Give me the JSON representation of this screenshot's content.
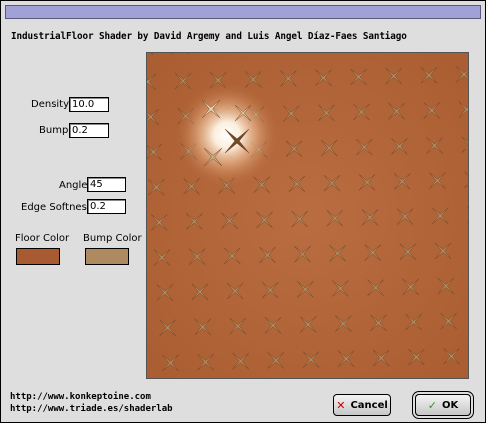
{
  "window": {
    "title": ""
  },
  "heading": "IndustrialFloor Shader by David Argemy and Luis Angel Díaz-Faes Santiago",
  "params": {
    "density": {
      "label": "Density",
      "value": "10.0"
    },
    "bump": {
      "label": "Bump",
      "value": "0.2"
    },
    "angle": {
      "label": "Angle",
      "value": "45"
    },
    "edge_softness": {
      "label": "Edge Softness",
      "value": "0.2"
    }
  },
  "colors": {
    "floor": {
      "label": "Floor Color",
      "value": "#a85a30"
    },
    "bump": {
      "label": "Bump Color",
      "value": "#ad8a60"
    }
  },
  "preview": {
    "base_color": "#b4683b",
    "highlight_color": "#fff6e8"
  },
  "links": {
    "url1": "http://www.konkeptoine.com",
    "url2": "http://www.triade.es/shaderlab"
  },
  "buttons": {
    "cancel": {
      "label": "Cancel",
      "icon": "x-icon",
      "color": "#cc0000"
    },
    "ok": {
      "label": "OK",
      "icon": "check-icon",
      "color": "#2a9a2a"
    }
  }
}
